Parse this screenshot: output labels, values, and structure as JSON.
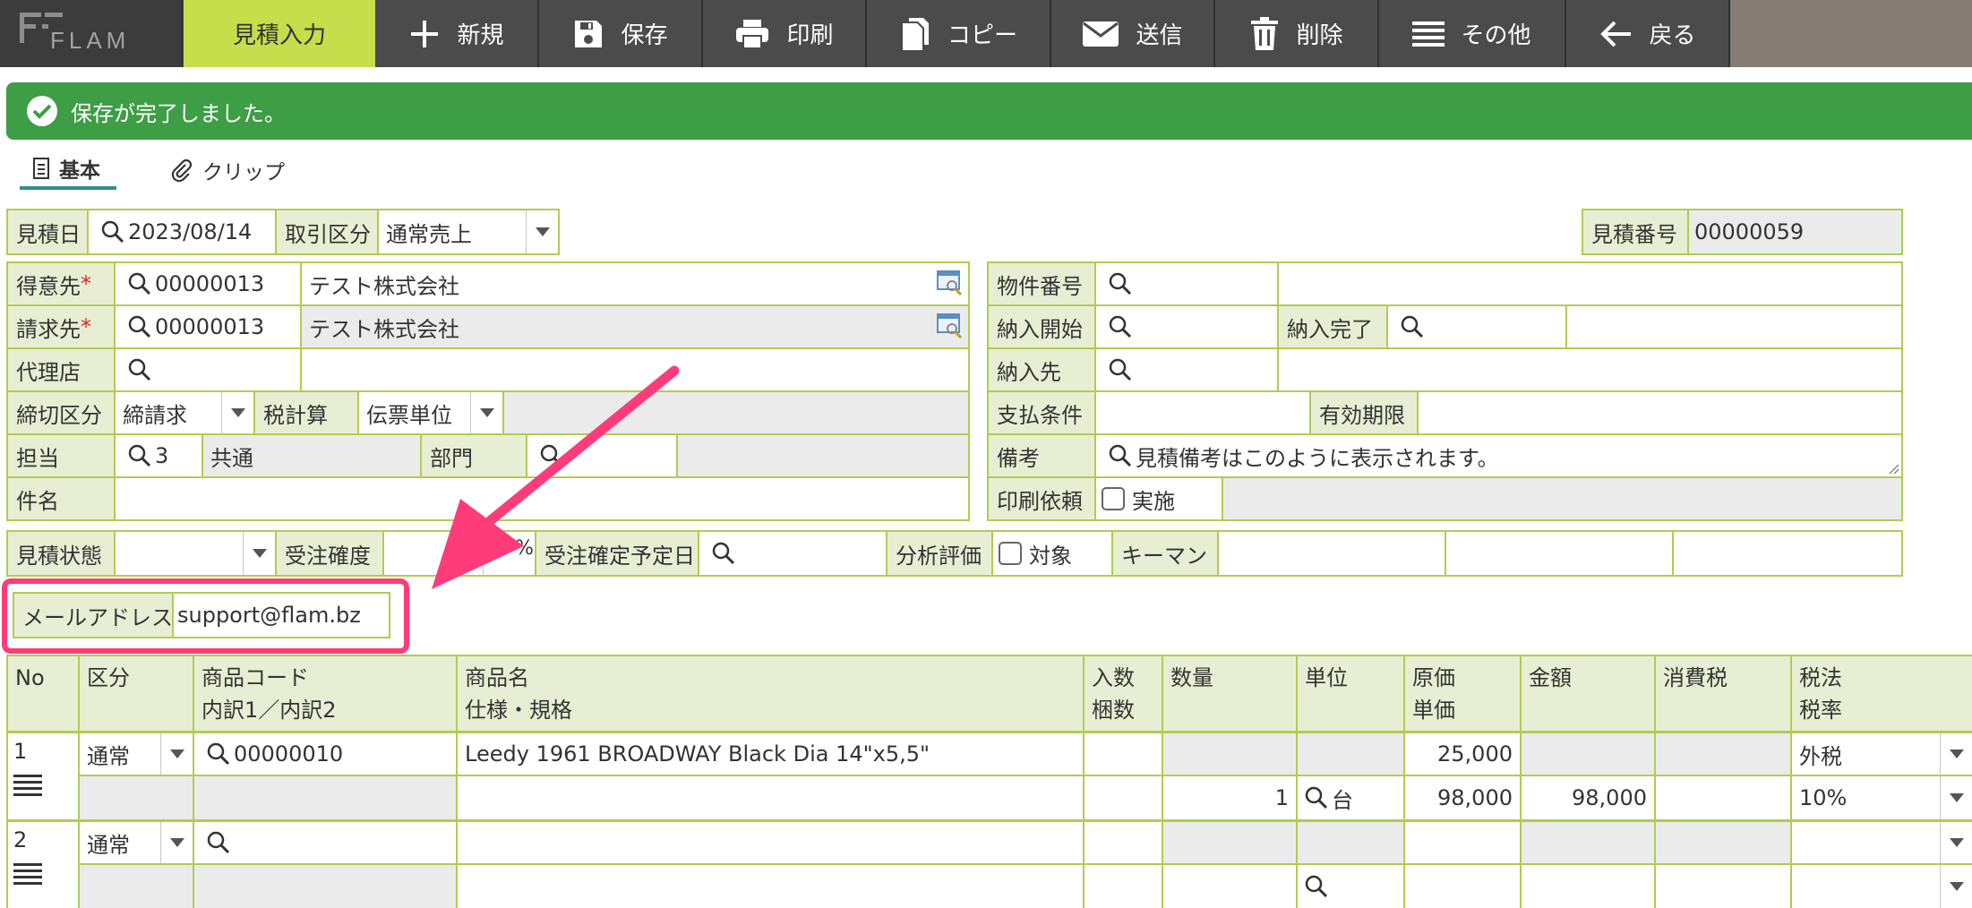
{
  "app": {
    "logo": "FLAM"
  },
  "toolbar": {
    "active": "見積入力",
    "new": "新規",
    "save": "保存",
    "print": "印刷",
    "copy": "コピー",
    "send": "送信",
    "delete": "削除",
    "more": "その他",
    "back": "戻る"
  },
  "banner": {
    "message": "保存が完了しました。"
  },
  "tabs": {
    "basic": "基本",
    "clip": "クリップ"
  },
  "header": {
    "date_label": "見積日",
    "date_value": "2023/08/14",
    "deal_label": "取引区分",
    "deal_value": "通常売上",
    "no_label": "見積番号",
    "no_value": "00000059"
  },
  "left": {
    "customer_label": "得意先",
    "customer_code": "00000013",
    "customer_name": "テスト株式会社",
    "billing_label": "請求先",
    "billing_code": "00000013",
    "billing_name": "テスト株式会社",
    "agent_label": "代理店",
    "closing_label": "締切区分",
    "closing_value": "締請求",
    "tax_calc_label": "税計算",
    "tax_calc_value": "伝票単位",
    "staff_label": "担当",
    "staff_code": "3",
    "staff_name": "共通",
    "dept_label": "部門",
    "subject_label": "件名"
  },
  "right": {
    "property_label": "物件番号",
    "delivery_start_label": "納入開始",
    "delivery_end_label": "納入完了",
    "delivery_to_label": "納入先",
    "payment_label": "支払条件",
    "validity_label": "有効期限",
    "remarks_label": "備考",
    "remarks_value": "見積備考はこのように表示されます。",
    "print_req_label": "印刷依頼",
    "print_req_check": "実施"
  },
  "status": {
    "state_label": "見積状態",
    "prob_label": "受注確度",
    "percent": "%",
    "due_label": "受注確定予定日",
    "analysis_label": "分析評価",
    "analysis_check": "対象",
    "keyman_label": "キーマン"
  },
  "email": {
    "label": "メールアドレス",
    "value": "support@flam.bz"
  },
  "annotation": {
    "color": "#ff3b7a"
  },
  "grid": {
    "headers": {
      "no": "No",
      "kubun": "区分",
      "code1": "商品コード",
      "code2": "内訳1／内訳2",
      "name1": "商品名",
      "name2": "仕様・規格",
      "irisu1": "入数",
      "irisu2": "梱数",
      "qty": "数量",
      "unit": "単位",
      "cost1": "原価",
      "cost2": "単価",
      "amount": "金額",
      "tax": "消費税",
      "taxlaw1": "税法",
      "taxlaw2": "税率"
    },
    "rows": [
      {
        "no": "1",
        "kubun": "通常",
        "code": "00000010",
        "name": "Leedy 1961 BROADWAY Black Dia 14\"x5,5\"",
        "cost": "25,000",
        "taxlaw": "外税",
        "qty": "1",
        "unit": "台",
        "price": "98,000",
        "amount": "98,000",
        "rate": "10%"
      },
      {
        "no": "2",
        "kubun": "通常"
      }
    ]
  }
}
